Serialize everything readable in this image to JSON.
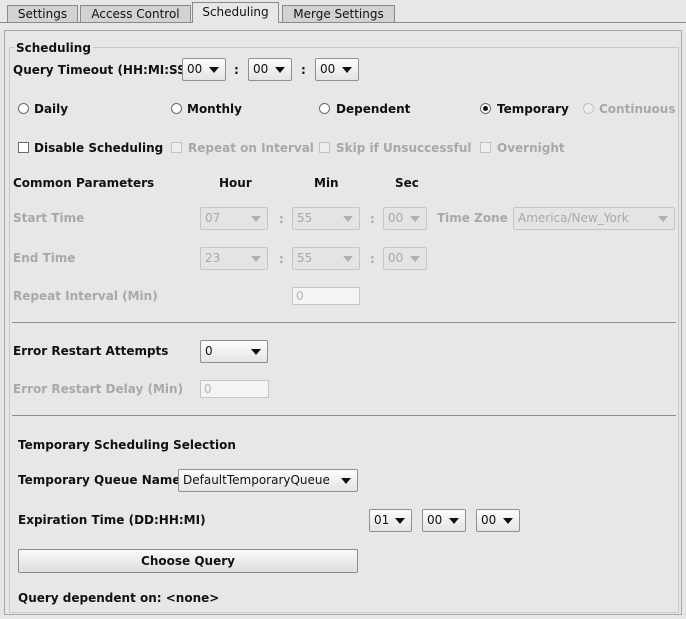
{
  "tabs": [
    {
      "label": "Settings",
      "active": false
    },
    {
      "label": "Access Control",
      "active": false
    },
    {
      "label": "Scheduling",
      "active": true
    },
    {
      "label": "Merge Settings",
      "active": false
    }
  ],
  "group_title": "Scheduling",
  "query_timeout": {
    "label": "Query Timeout (HH:MI:SS)",
    "hh": "00",
    "mi": "00",
    "ss": "00",
    "sep": ":"
  },
  "schedule_types": [
    {
      "label": "Daily",
      "selected": false,
      "enabled": true
    },
    {
      "label": "Monthly",
      "selected": false,
      "enabled": true
    },
    {
      "label": "Dependent",
      "selected": false,
      "enabled": true
    },
    {
      "label": "Temporary",
      "selected": true,
      "enabled": true
    },
    {
      "label": "Continuous",
      "selected": false,
      "enabled": false
    }
  ],
  "options": [
    {
      "label": "Disable Scheduling",
      "checked": false,
      "enabled": true
    },
    {
      "label": "Repeat on Interval",
      "checked": false,
      "enabled": false
    },
    {
      "label": "Skip if Unsuccessful",
      "checked": false,
      "enabled": false
    },
    {
      "label": "Overnight",
      "checked": false,
      "enabled": false
    }
  ],
  "common": {
    "title": "Common Parameters",
    "hour_header": "Hour",
    "min_header": "Min",
    "sec_header": "Sec",
    "start_label": "Start Time",
    "start_hour": "07",
    "start_min": "55",
    "start_sec": "00",
    "timezone_label": "Time Zone",
    "timezone": "America/New_York",
    "end_label": "End Time",
    "end_hour": "23",
    "end_min": "55",
    "end_sec": "00",
    "repeat_label": "Repeat Interval (Min)",
    "repeat_value": "0"
  },
  "error": {
    "attempts_label": "Error Restart Attempts",
    "attempts_value": "0",
    "delay_label": "Error Restart Delay (Min)",
    "delay_value": "0"
  },
  "temporary": {
    "title": "Temporary Scheduling Selection",
    "queue_label": "Temporary Queue Name",
    "queue_value": "DefaultTemporaryQueue",
    "expiration_label": "Expiration Time (DD:HH:MI)",
    "exp_dd": "01",
    "exp_hh": "00",
    "exp_mi": "00",
    "choose_query_label": "Choose Query",
    "dependent_label": "Query dependent on: <none>"
  }
}
